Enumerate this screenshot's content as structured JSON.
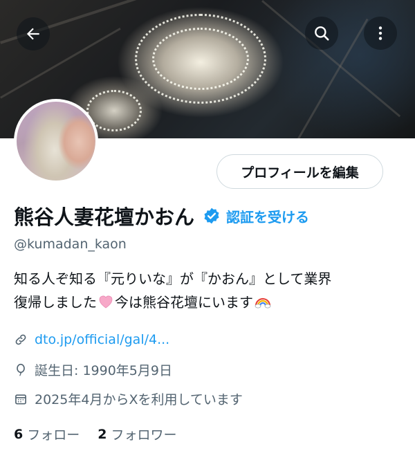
{
  "header": {
    "back_icon": "arrow-left-icon",
    "search_icon": "search-icon",
    "more_icon": "more-vertical-icon"
  },
  "profile": {
    "edit_button_label": "プロフィールを編集",
    "display_name": "熊谷人妻花壇かおん",
    "verify_label": "認証を受ける",
    "handle": "@kumadan_kaon",
    "bio_line1": "知る人ぞ知る『元りいな』が『かおん』として業界",
    "bio_line2_a": "復帰しました",
    "bio_line2_b": "今は熊谷花壇にいます",
    "link_text": "dto.jp/official/gal/4...",
    "birthday": "誕生日: 1990年5月9日",
    "joined": "2025年4月からXを利用しています",
    "following_count": "6",
    "following_label": "フォロー",
    "followers_count": "2",
    "followers_label": "フォロワー"
  },
  "colors": {
    "accent": "#1d9bf0",
    "text": "#0f1419",
    "secondary_text": "#536471",
    "border": "#cfd9de"
  }
}
